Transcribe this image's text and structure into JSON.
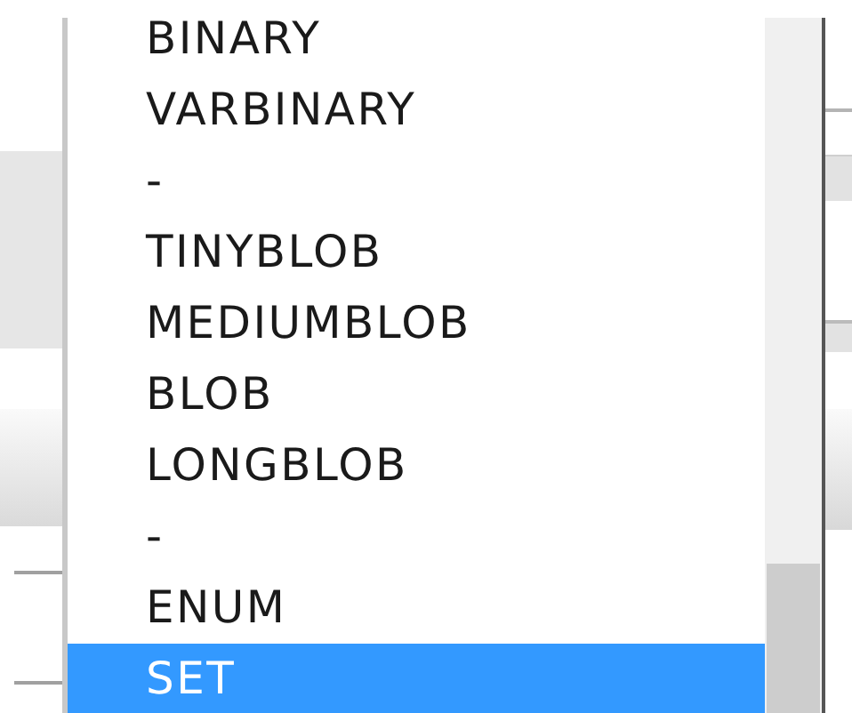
{
  "dropdown_list": {
    "items": [
      {
        "label": "BINARY",
        "selected": false
      },
      {
        "label": "VARBINARY",
        "selected": false
      },
      {
        "label": "-",
        "selected": false
      },
      {
        "label": "TINYBLOB",
        "selected": false
      },
      {
        "label": "MEDIUMBLOB",
        "selected": false
      },
      {
        "label": "BLOB",
        "selected": false
      },
      {
        "label": "LONGBLOB",
        "selected": false
      },
      {
        "label": "-",
        "selected": false
      },
      {
        "label": "ENUM",
        "selected": false
      },
      {
        "label": "SET",
        "selected": true
      }
    ]
  }
}
